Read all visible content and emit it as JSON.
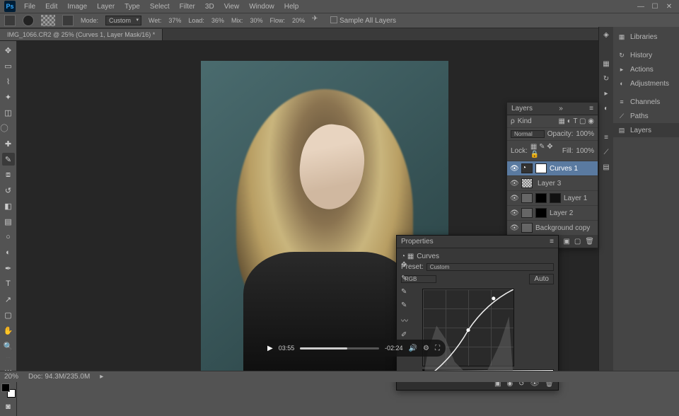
{
  "menu": [
    "File",
    "Edit",
    "Image",
    "Layer",
    "Type",
    "Select",
    "Filter",
    "3D",
    "View",
    "Window",
    "Help"
  ],
  "optbar": {
    "mode_label": "Mode:",
    "mode_value": "Custom",
    "wet_label": "Wet:",
    "wet_value": "37%",
    "load_label": "Load:",
    "load_value": "36%",
    "mix_label": "Mix:",
    "mix_value": "30%",
    "flow_label": "Flow:",
    "flow_value": "20%",
    "sample_label": "Sample All Layers"
  },
  "doc_tab": "IMG_1066.CR2 @ 25% (Curves 1, Layer Mask/16) *",
  "right_strip": [
    "Libraries",
    "History",
    "Actions",
    "Adjustments",
    "Channels",
    "Paths",
    "Layers"
  ],
  "layers": {
    "title": "Layers",
    "kind": "Kind",
    "blend": "Normal",
    "opacity_label": "Opacity:",
    "opacity": "100%",
    "lock_label": "Lock:",
    "fill_label": "Fill:",
    "fill": "100%",
    "items": [
      {
        "name": "Curves 1",
        "sel": true,
        "adj": true
      },
      {
        "name": "Layer 3"
      },
      {
        "name": "Layer 1",
        "masks": 2
      },
      {
        "name": "Layer 2",
        "masks": 1
      },
      {
        "name": "Background copy"
      }
    ]
  },
  "props": {
    "title": "Properties",
    "type": "Curves",
    "preset_label": "Preset:",
    "preset": "Custom",
    "channel": "RGB",
    "auto": "Auto"
  },
  "video": {
    "elapsed": "03:55",
    "remaining": "-02:24"
  },
  "status": {
    "zoom": "20%",
    "doc": "Doc: 94.3M/235.0M"
  }
}
